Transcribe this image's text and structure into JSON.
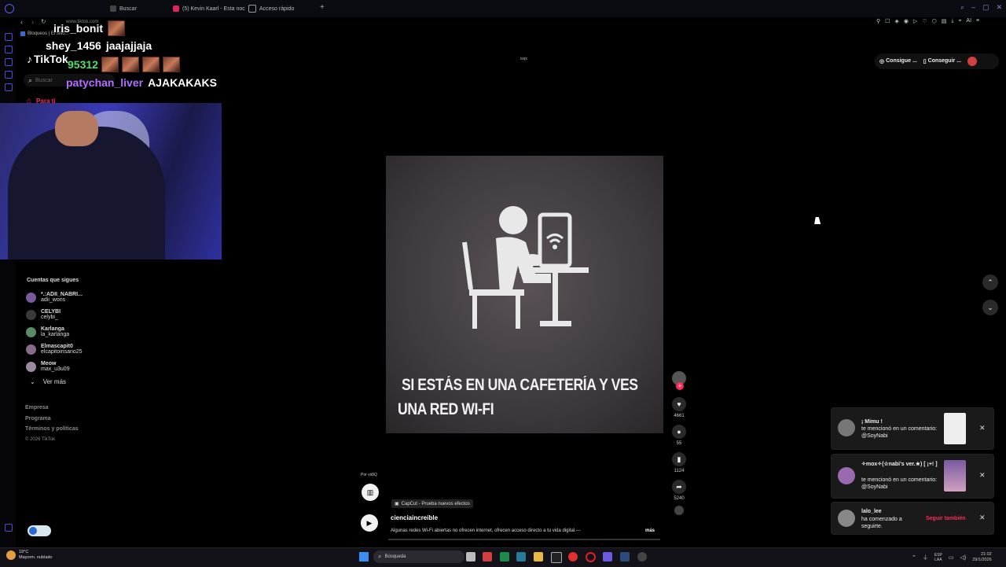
{
  "browser": {
    "tabs": [
      {
        "label": "Buscar"
      },
      {
        "label": "(5) Kevin Kaarl - Esta noc"
      },
      {
        "label": "Acceso rápido"
      }
    ],
    "url": "www.tiktok.com",
    "site_notice": "Bloqueos | El sitio..."
  },
  "chat": {
    "messages": [
      {
        "user": "iris_bonit",
        "text": ""
      },
      {
        "user": "shey_1456",
        "text": "jaajajjaja"
      },
      {
        "user": "95312",
        "text": ""
      },
      {
        "user": "patychan_liver",
        "text": "AJAKAKAKS"
      }
    ],
    "user_colors": [
      "#ffffff",
      "#ffffff",
      "#4ee06a",
      "#b06fff"
    ]
  },
  "tiktok": {
    "logo": "TikTok",
    "search_placeholder": "Buscar",
    "nav_for_you": "Para ti",
    "following_header": "Cuentas que sigues",
    "following": [
      {
        "name": "*.:ADII_NABRI...",
        "handle": "adii_wons"
      },
      {
        "name": "CELYBI",
        "handle": "celybi_"
      },
      {
        "name": "Karlanga",
        "handle": "la_karlanga"
      },
      {
        "name": "Elmascapit0",
        "handle": "elcapitoinsano25"
      },
      {
        "name": "Meow",
        "handle": "max_u3u09"
      }
    ],
    "see_more": "Ver más",
    "footer": [
      "Empresa",
      "Programa",
      "Términos y políticas",
      "© 2026 TikTok"
    ],
    "top_right": {
      "btn1": "Consigue ...",
      "btn2": "Conseguir ..."
    },
    "video_label": "isqx",
    "video_caption_line1": "SI ESTÁS EN UNA CAFETERÍA Y VES",
    "video_caption_line2": "UNA RED WI-FI",
    "actions": {
      "likes": "4661",
      "comments": "55",
      "saves": "1124",
      "shares": "5240"
    },
    "author_label": "Por vidIQ",
    "effect": "CapCut - Prueba nuevos efectos",
    "username": "cienciaincreible",
    "description": "Algunas redes Wi-Fi abiertas no ofrecen internet, ofrecen acceso directo a tu vida digital.---",
    "more": "más"
  },
  "notifications": [
    {
      "name": "¡ Mimu !",
      "text": "te mencionó en un comentario: @SoyNabi"
    },
    {
      "name": "✧mox✧(☆nabi's ver.★) [ ¡+! ]",
      "text": "te mencionó en un comentario: @SoyNabi"
    },
    {
      "name": "lalo_lee",
      "text": "ha comenzado a seguirte.",
      "action": "Seguir también"
    }
  ],
  "taskbar": {
    "weather_temp": "19°C",
    "weather_desc": "Mayorm. nublado",
    "search": "Búsqueda",
    "lang": "ESP",
    "lang2": "LAA",
    "time": "21:02",
    "date": "29/1/2026"
  }
}
